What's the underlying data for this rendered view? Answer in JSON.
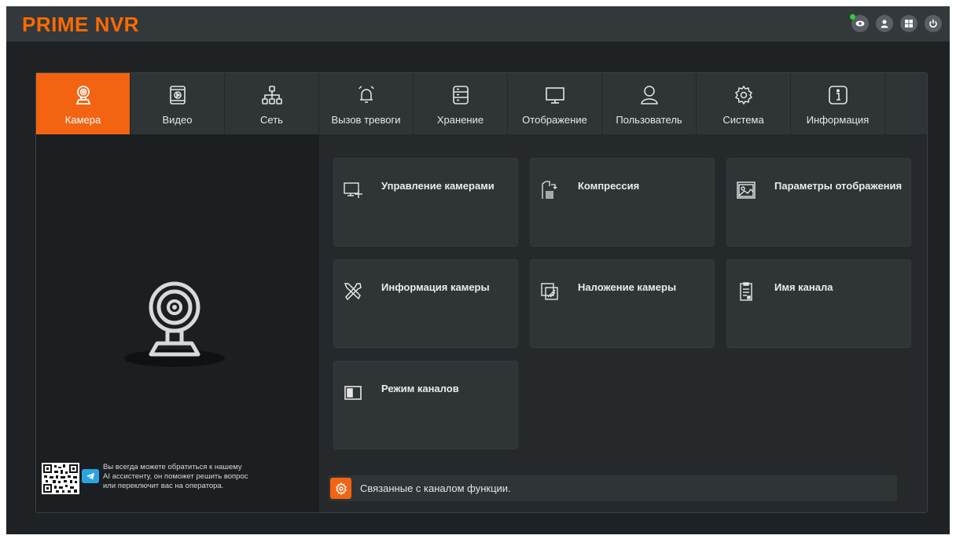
{
  "app": {
    "brand": "PRIME NVR",
    "accent_color": "#f26412",
    "brand_color": "#ff6a00"
  },
  "top_icons": [
    {
      "name": "eye-icon",
      "status": "online"
    },
    {
      "name": "user-icon"
    },
    {
      "name": "layout-icon"
    },
    {
      "name": "power-icon"
    }
  ],
  "tabs": [
    {
      "label": "Камера",
      "icon": "camera-icon",
      "active": true
    },
    {
      "label": "Видео",
      "icon": "video-icon"
    },
    {
      "label": "Сеть",
      "icon": "network-icon"
    },
    {
      "label": "Вызов тревоги",
      "icon": "alarm-bell-icon"
    },
    {
      "label": "Хранение",
      "icon": "storage-icon"
    },
    {
      "label": "Отображение",
      "icon": "monitor-icon"
    },
    {
      "label": "Пользователь",
      "icon": "user-icon"
    },
    {
      "label": "Система",
      "icon": "gear-icon"
    },
    {
      "label": "Информация",
      "icon": "info-icon"
    }
  ],
  "cards": [
    {
      "label": "Управление камерами",
      "icon": "camera-manage-icon"
    },
    {
      "label": "Компрессия",
      "icon": "compression-icon"
    },
    {
      "label": "Параметры отображения",
      "icon": "image-params-icon"
    },
    {
      "label": "Информация камеры",
      "icon": "tools-icon"
    },
    {
      "label": "Наложение камеры",
      "icon": "overlay-icon"
    },
    {
      "label": "Имя канала",
      "icon": "clipboard-icon"
    },
    {
      "label": "Режим каналов",
      "icon": "channel-mode-icon"
    }
  ],
  "assistant": {
    "line1": "Вы всегда можете обратиться к нашему",
    "line2": "AI ассистенту, он поможет решить вопрос",
    "line3": "или переключит вас на оператора."
  },
  "footer": {
    "text": "Связанные с каналом функции."
  }
}
